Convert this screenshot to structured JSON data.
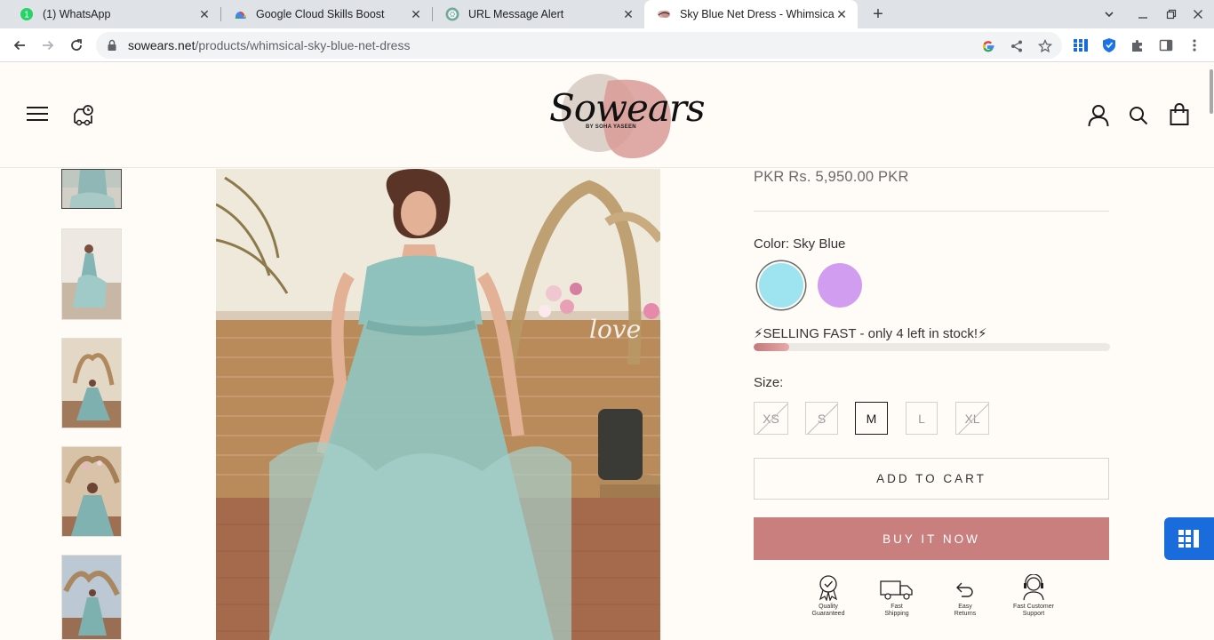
{
  "browser": {
    "tabs": [
      {
        "title": "(1) WhatsApp",
        "icon": "whatsapp-icon",
        "active": false
      },
      {
        "title": "Google Cloud Skills Boost",
        "icon": "google-cloud-icon",
        "active": false
      },
      {
        "title": "URL Message Alert",
        "icon": "chatgpt-icon",
        "active": false
      },
      {
        "title": "Sky Blue Net Dress - Whimsical | ",
        "icon": "sowears-favicon",
        "active": true
      }
    ],
    "url_host": "sowears.net",
    "url_path": "/products/whimsical-sky-blue-net-dress"
  },
  "site": {
    "logo_text": "Sowears",
    "logo_subtext": "BY SOHA YASEEN"
  },
  "product": {
    "price": "PKR Rs. 5,950.00 PKR",
    "color_label": "Color: Sky Blue",
    "swatches": [
      {
        "name": "Sky Blue",
        "color": "#9ee4f0",
        "selected": true
      },
      {
        "name": "Lilac",
        "color": "#d09df0",
        "selected": false
      }
    ],
    "stock_text": "⚡SELLING FAST - only 4 left in stock!⚡",
    "stock_fraction": 0.1,
    "size_label": "Size:",
    "sizes": [
      {
        "label": "XS",
        "available": false,
        "selected": false
      },
      {
        "label": "S",
        "available": false,
        "selected": false
      },
      {
        "label": "M",
        "available": true,
        "selected": true
      },
      {
        "label": "L",
        "available": true,
        "selected": false
      },
      {
        "label": "XL",
        "available": false,
        "selected": false
      }
    ],
    "add_to_cart": "ADD TO CART",
    "buy_now": "BUY IT NOW",
    "badges": [
      {
        "line1": "Quality",
        "line2": "Guaranteed"
      },
      {
        "line1": "Fast",
        "line2": "Shipping"
      },
      {
        "line1": "Easy",
        "line2": "Returns"
      },
      {
        "line1": "Fast Customer",
        "line2": "Support"
      }
    ]
  },
  "colors": {
    "accent": "#c87f7e",
    "page_bg": "#fffbf6"
  }
}
